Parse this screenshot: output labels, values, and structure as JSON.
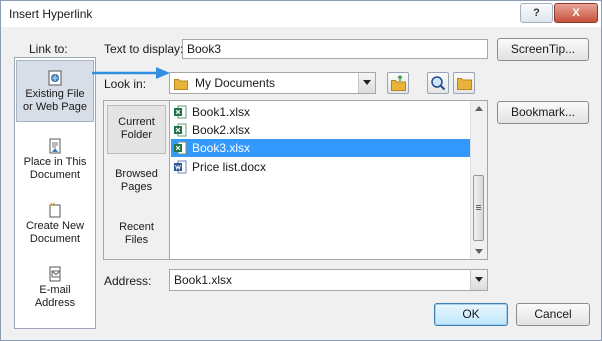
{
  "window": {
    "title": "Insert Hyperlink",
    "help_label": "?",
    "close_label": "X"
  },
  "header": {
    "link_to_label": "Link to:",
    "text_to_display_label": "Text to display:",
    "text_to_display_value": "Book3",
    "screentip_label": "ScreenTip..."
  },
  "link_to": {
    "items": [
      {
        "label1": "Existing File",
        "label2": "or Web Page",
        "icon": "existing-file-icon",
        "selected": true
      },
      {
        "label1": "Place in This",
        "label2": "Document",
        "icon": "place-in-document-icon",
        "selected": false
      },
      {
        "label1": "Create New",
        "label2": "Document",
        "icon": "create-new-document-icon",
        "selected": false
      },
      {
        "label1": "E-mail",
        "label2": "Address",
        "icon": "email-address-icon",
        "selected": false
      }
    ]
  },
  "look_in": {
    "label": "Look in:",
    "value": "My Documents"
  },
  "tools": {
    "browse_web_icon": "browse-web-icon",
    "browse_file_icon": "browse-file-icon",
    "folder_up_icon": "folder-up-icon"
  },
  "sub_nav": {
    "items": [
      {
        "label1": "Current",
        "label2": "Folder",
        "selected": true
      },
      {
        "label1": "Browsed",
        "label2": "Pages",
        "selected": false
      },
      {
        "label1": "Recent",
        "label2": "Files",
        "selected": false
      }
    ]
  },
  "files": [
    {
      "name": "Book1.xlsx",
      "type": "excel-file-icon",
      "selected": false
    },
    {
      "name": "Book2.xlsx",
      "type": "excel-file-icon",
      "selected": false
    },
    {
      "name": "Book3.xlsx",
      "type": "excel-file-icon",
      "selected": true
    },
    {
      "name": "Price list.docx",
      "type": "word-file-icon",
      "selected": false
    }
  ],
  "bookmark_label": "Bookmark...",
  "address": {
    "label": "Address:",
    "value": "Book1.xlsx"
  },
  "buttons": {
    "ok": "OK",
    "cancel": "Cancel"
  },
  "colors": {
    "selection": "#3399ff",
    "arrow": "#2f8fe0",
    "excel": "#1e7145",
    "word": "#2b579a",
    "folder": "#e8b33a"
  }
}
